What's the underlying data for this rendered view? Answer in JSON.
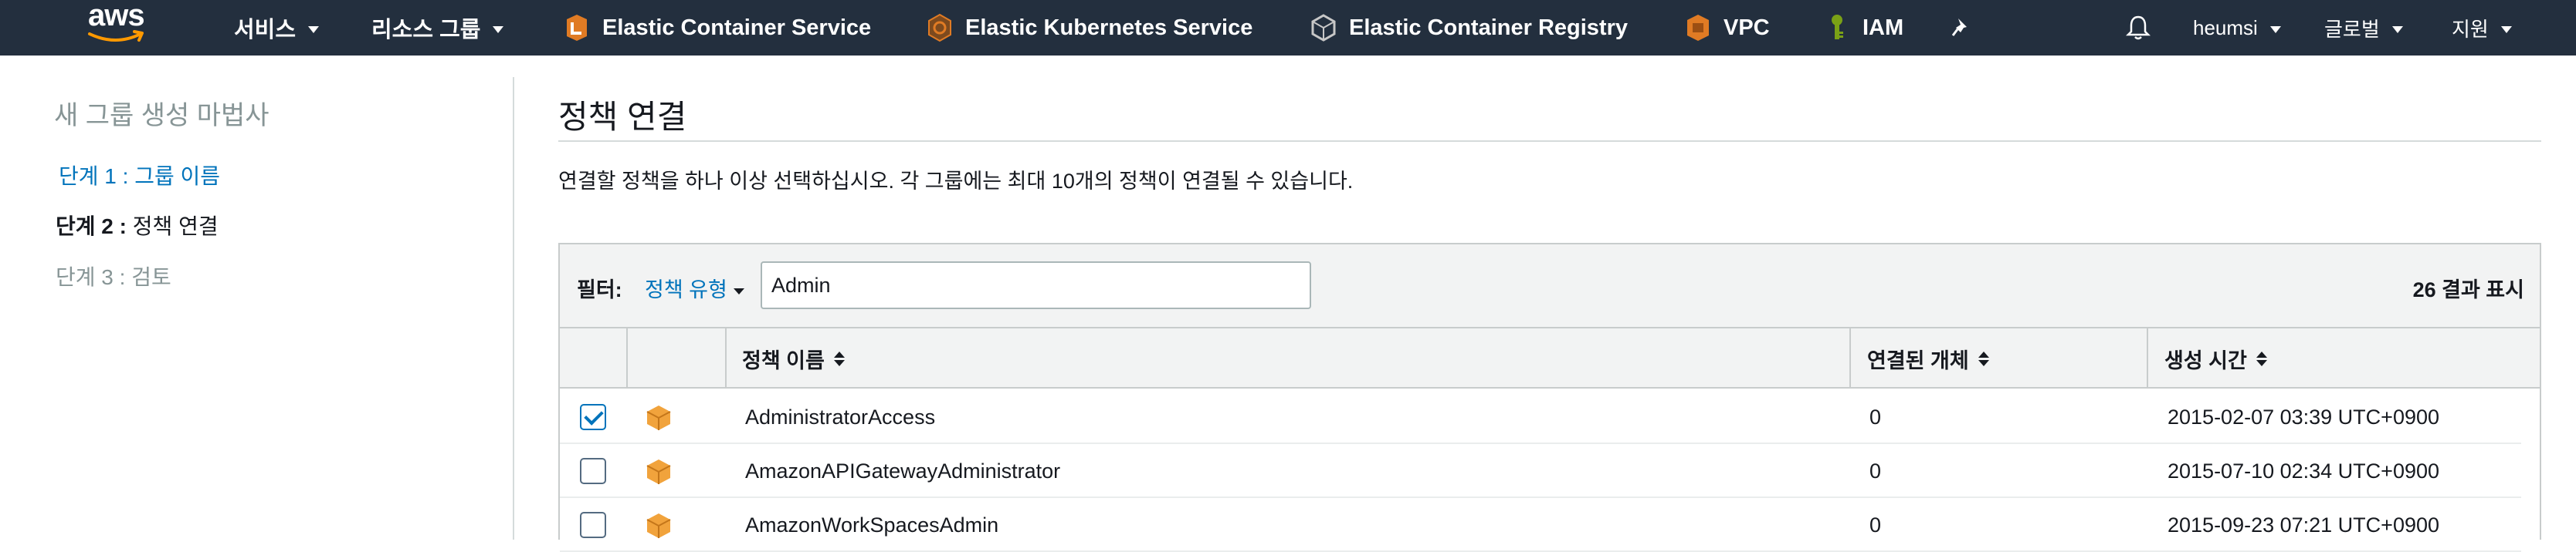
{
  "header": {
    "logo_text": "aws",
    "services_label": "서비스",
    "resource_groups_label": "리소스 그룹",
    "shortcuts": [
      {
        "label": "Elastic Container Service",
        "icon": "ecs-icon",
        "color": "#e07b24"
      },
      {
        "label": "Elastic Kubernetes Service",
        "icon": "eks-icon",
        "color": "#e07b24"
      },
      {
        "label": "Elastic Container Registry",
        "icon": "ecr-icon",
        "color": "#c7c7c7"
      },
      {
        "label": "VPC",
        "icon": "vpc-icon",
        "color": "#e07b24"
      },
      {
        "label": "IAM",
        "icon": "iam-key-icon",
        "color": "#7aa116"
      }
    ],
    "user_label": "heumsi",
    "region_label": "글로벌",
    "support_label": "지원"
  },
  "sidebar": {
    "title": "새 그룹 생성 마법사",
    "step1": "단계 1 : 그룹 이름",
    "step2_prefix": "단계 2 :",
    "step2_label": "정책 연결",
    "step3": "단계 3 : 검토"
  },
  "main": {
    "title": "정책 연결",
    "description": "연결할 정책을 하나 이상 선택하십시오. 각 그룹에는 최대 10개의 정책이 연결될 수 있습니다.",
    "filter_label": "필터:",
    "filter_type_label": "정책 유형",
    "search_value": "Admin",
    "result_count": "26 결과 표시",
    "columns": {
      "name": "정책 이름",
      "attached": "연결된 개체",
      "created": "생성 시간"
    },
    "rows": [
      {
        "name": "AdministratorAccess",
        "attached": "0",
        "created": "2015-02-07 03:39 UTC+0900",
        "checked": true
      },
      {
        "name": "AmazonAPIGatewayAdministrator",
        "attached": "0",
        "created": "2015-07-10 02:34 UTC+0900",
        "checked": false
      },
      {
        "name": "AmazonWorkSpacesAdmin",
        "attached": "0",
        "created": "2015-09-23 07:21 UTC+0900",
        "checked": false
      }
    ]
  },
  "colors": {
    "nav_bg": "#232f3e",
    "link": "#0073bb",
    "policy_icon": "#f1a33c"
  }
}
